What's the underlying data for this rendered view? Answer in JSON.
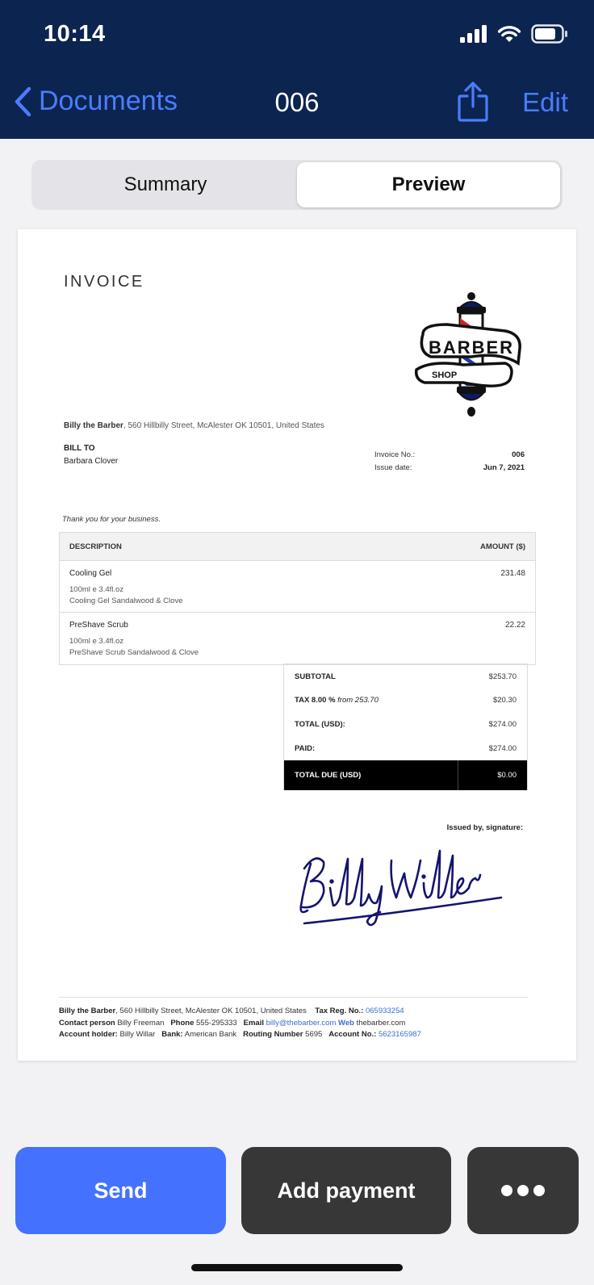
{
  "status_bar": {
    "time": "10:14"
  },
  "nav": {
    "back_label": "Documents",
    "title": "006",
    "edit_label": "Edit"
  },
  "segment": {
    "tabs": [
      "Summary",
      "Preview"
    ],
    "selected": "Preview"
  },
  "invoice": {
    "heading": "INVOICE",
    "logo": {
      "line1": "BARBER",
      "line2": "SHOP"
    },
    "sender_name": "Billy the Barber",
    "sender_address": ", 560 Hillbilly Street, McAlester OK 10501, United States",
    "bill_to_label": "BILL TO",
    "bill_to_name": "Barbara Clover",
    "invoice_no_label": "Invoice No.:",
    "invoice_no": "006",
    "issue_date_label": "Issue date:",
    "issue_date": "Jun 7, 2021",
    "thanks": "Thank you for your business.",
    "columns": {
      "description": "DESCRIPTION",
      "amount": "AMOUNT ($)"
    },
    "items": [
      {
        "name": "Cooling Gel",
        "amount": "231.48",
        "detail1": "100ml e 3.4fl.oz",
        "detail2": "Cooling Gel Sandalwood & Clove"
      },
      {
        "name": "PreShave Scrub",
        "amount": "22.22",
        "detail1": "100ml e 3.4fl.oz",
        "detail2": "PreShave Scrub Sandalwood & Clove"
      }
    ],
    "totals": {
      "subtotal_label": "SUBTOTAL",
      "subtotal": "$253.70",
      "tax_label": "TAX 8.00 %",
      "tax_from": "from 253.70",
      "tax": "$20.30",
      "total_label": "TOTAL (USD):",
      "total": "$274.00",
      "paid_label": "PAID:",
      "paid": "$274.00",
      "due_label": "TOTAL DUE (USD)",
      "due": "$0.00"
    },
    "issued_by": "Issued by, signature:",
    "signature_text": "Billy Willar",
    "footer": {
      "company": "Billy the Barber",
      "address": ", 560 Hillbilly Street, McAlester OK 10501, United States",
      "tax_reg_label": "Tax Reg. No.:",
      "tax_reg": "065933254",
      "contact_label": "Contact person",
      "contact": "Billy Freeman",
      "phone_label": "Phone",
      "phone": "555-295333",
      "email_label": "Email",
      "email": "billy@thebarber.com",
      "web_label": "Web",
      "web": "thebarber.com",
      "holder_label": "Account holder:",
      "holder": "Billy Willar",
      "bank_label": "Bank:",
      "bank": "American Bank",
      "routing_label": "Routing Number",
      "routing": "5695",
      "account_label": "Account No.:",
      "account": "5623165987"
    }
  },
  "actions": {
    "send": "Send",
    "add_payment": "Add payment",
    "more_icon": "ellipsis-icon"
  },
  "colors": {
    "nav_bg": "#0c2450",
    "accent": "#4472ff",
    "link": "#4a7dff",
    "dark_button": "#373737"
  }
}
